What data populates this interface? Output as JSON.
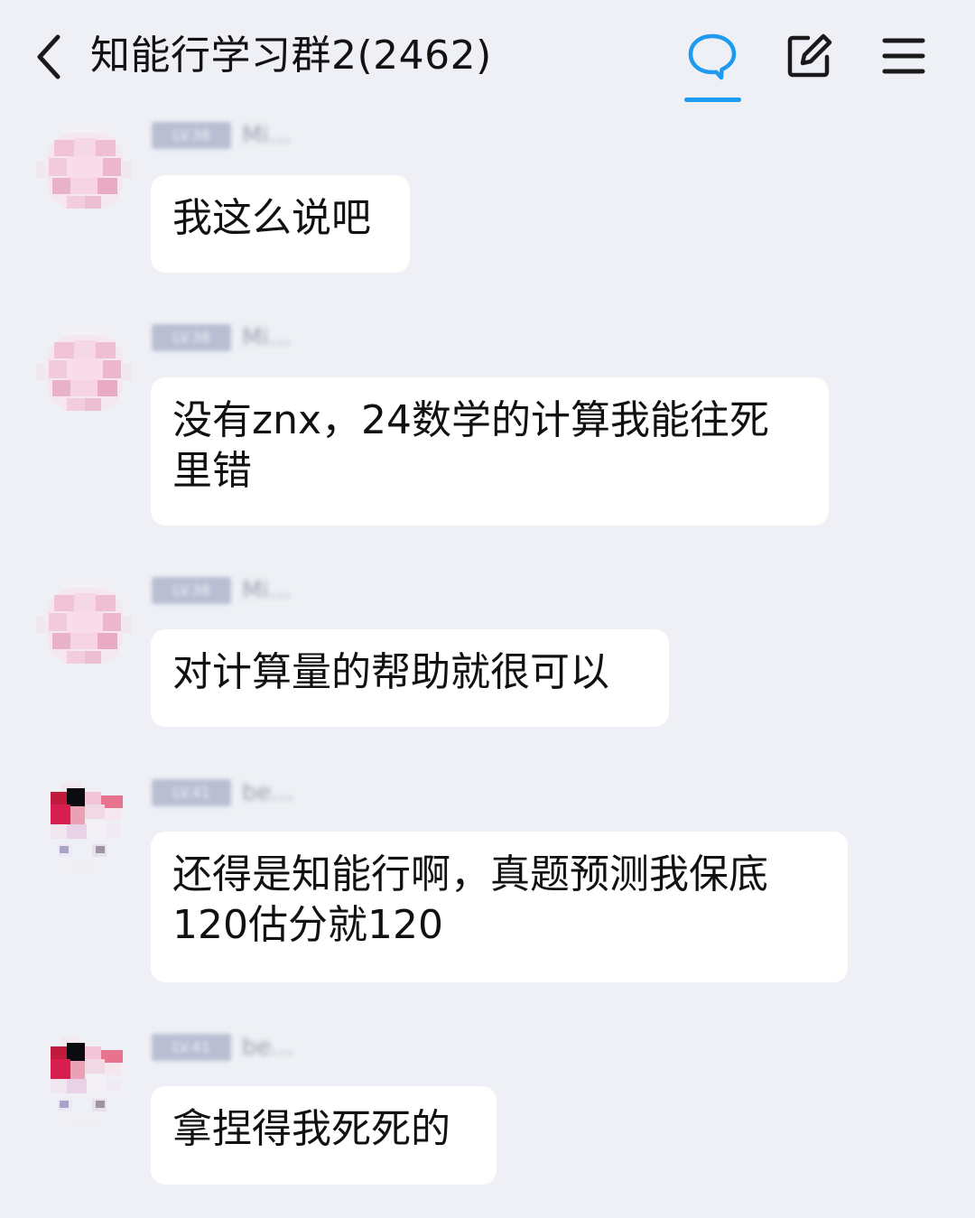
{
  "header": {
    "title": "知能行学习群2(2462)",
    "back_icon": "chevron-left-icon",
    "chat_icon": "chat-bubble-icon",
    "edit_icon": "edit-icon",
    "menu_icon": "menu-icon",
    "accent_color": "#1e9bf0"
  },
  "messages": [
    {
      "sender_badge": "LV.38",
      "sender_name": "Mi...",
      "text": "我这么说吧"
    },
    {
      "sender_badge": "LV.38",
      "sender_name": "Mi...",
      "text": "没有znx，24数学的计算我能往死里错"
    },
    {
      "sender_badge": "LV.38",
      "sender_name": "Mi...",
      "text": "对计算量的帮助就很可以"
    },
    {
      "sender_badge": "LV.41",
      "sender_name": "be...",
      "text": "还得是知能行啊，真题预测我保底120估分就120"
    },
    {
      "sender_badge": "LV.41",
      "sender_name": "be...",
      "text": "拿捏得我死死的"
    }
  ]
}
